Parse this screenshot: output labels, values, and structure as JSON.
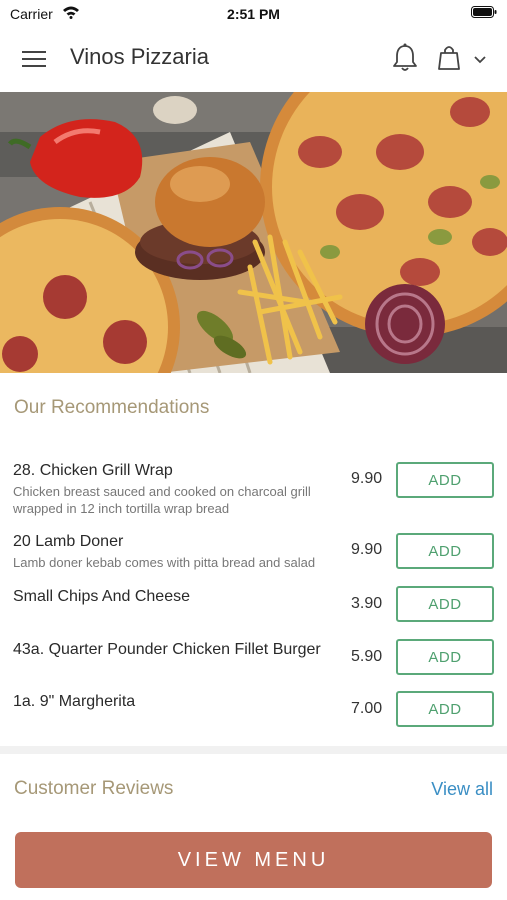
{
  "status_bar": {
    "carrier": "Carrier",
    "time": "2:51 PM"
  },
  "header": {
    "title": "Vinos Pizzaria",
    "icons": [
      "menu-icon",
      "bell-icon",
      "shopping-bag-icon",
      "chevron-down-icon"
    ]
  },
  "hero": {
    "image": "food-banner"
  },
  "recommendations": {
    "title": "Our Recommendations",
    "add_label": "ADD",
    "items": [
      {
        "name": "28. Chicken Grill Wrap",
        "description": "Chicken breast sauced and cooked on charcoal grill wrapped in 12 inch tortilla wrap bread",
        "price": "9.90"
      },
      {
        "name": "20 Lamb Doner",
        "description": "Lamb doner kebab comes with pitta bread and salad",
        "price": "9.90"
      },
      {
        "name": "Small Chips And Cheese",
        "description": "",
        "price": "3.90"
      },
      {
        "name": "43a. Quarter Pounder Chicken Fillet Burger",
        "description": "",
        "price": "5.90"
      },
      {
        "name": "1a. 9\" Margherita",
        "description": "",
        "price": "7.00"
      }
    ]
  },
  "reviews": {
    "title": "Customer Reviews",
    "view_all": "View all"
  },
  "footer": {
    "button_label": "VIEW MENU"
  },
  "colors": {
    "accent_title": "#a69877",
    "add_green": "#4fa06f",
    "link_blue": "#3a8ec4",
    "menu_button": "#c0705c"
  }
}
